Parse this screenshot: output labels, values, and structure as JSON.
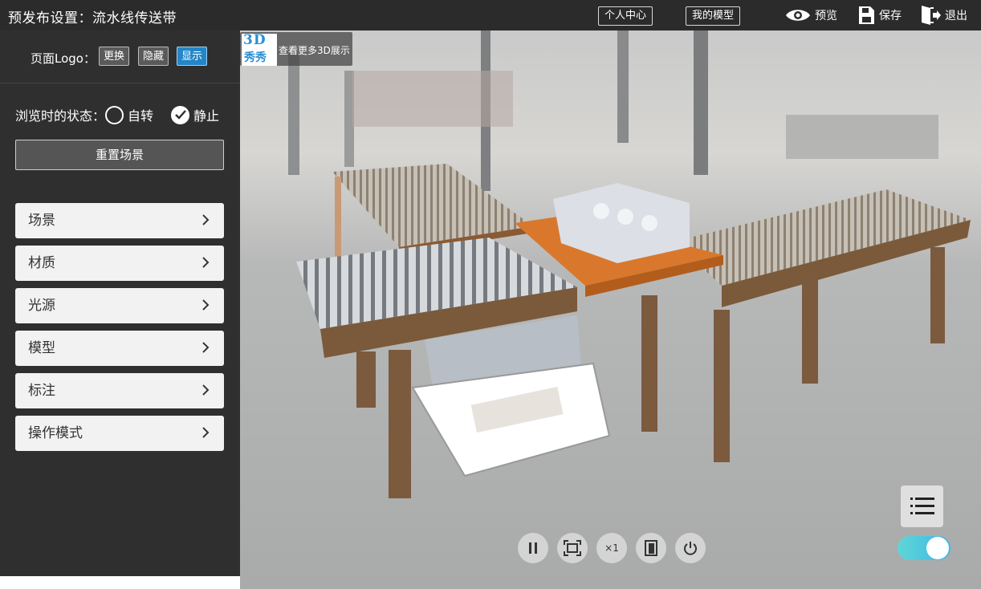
{
  "header": {
    "title": "预发布设置：流水线传送带",
    "user_center": "个人中心",
    "my_models": "我的模型",
    "preview": "预览",
    "save": "保存",
    "logout": "退出"
  },
  "sidebar": {
    "logo_label": "页面Logo：",
    "logo_buttons": [
      "更换",
      "隐藏",
      "显示"
    ],
    "browse_state_label": "浏览时的状态：",
    "state_options": [
      "自转",
      "静止"
    ],
    "selected_state": "静止",
    "reset_button": "重置场景",
    "menu": [
      "场景",
      "材质",
      "光源",
      "模型",
      "标注",
      "操作模式"
    ]
  },
  "viewport": {
    "brand_logo_text": [
      "3D",
      "秀秀"
    ],
    "brand_link": "查看更多3D展示",
    "speed_label": "×1",
    "auto_rotate_toggle": true
  },
  "colors": {
    "topbar": "#2b2b2b",
    "sidebar": "#2f2f2f",
    "active_button": "#2386c8",
    "toggle_on": "#3eb7e6"
  }
}
